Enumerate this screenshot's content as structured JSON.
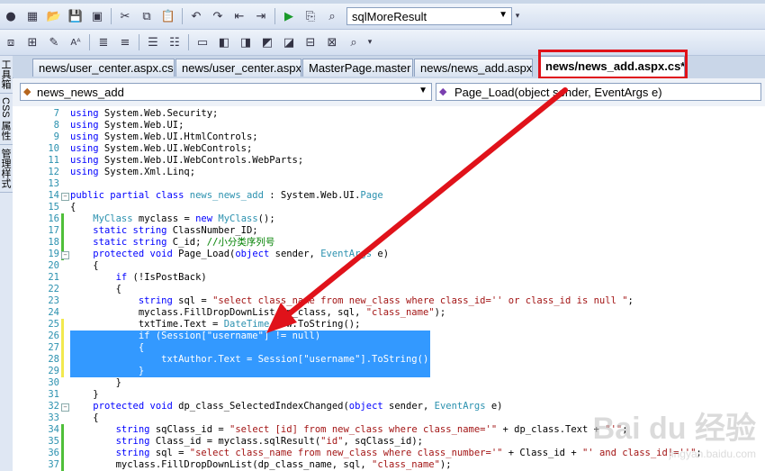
{
  "toolbar1": {
    "config_combo": "sqlMoreResult"
  },
  "left_panel": {
    "tabs": [
      "工具箱",
      "CSS 属性",
      "管理样式"
    ]
  },
  "document_tabs": [
    {
      "label": "news/user_center.aspx.cs"
    },
    {
      "label": "news/user_center.aspx"
    },
    {
      "label": "MasterPage.master"
    },
    {
      "label": "news/news_add.aspx"
    },
    {
      "label": "news/news_add.aspx.cs*"
    }
  ],
  "nav": {
    "class_combo": "news_news_add",
    "member_combo": "Page_Load(object sender, EventArgs e)"
  },
  "code": {
    "lines": [
      {
        "n": "7",
        "html": "<span class=\"kw\">using</span> System.Web.Security;"
      },
      {
        "n": "8",
        "html": "<span class=\"kw\">using</span> System.Web.UI;"
      },
      {
        "n": "9",
        "html": "<span class=\"kw\">using</span> System.Web.UI.HtmlControls;"
      },
      {
        "n": "10",
        "html": "<span class=\"kw\">using</span> System.Web.UI.WebControls;"
      },
      {
        "n": "11",
        "html": "<span class=\"kw\">using</span> System.Web.UI.WebControls.WebParts;"
      },
      {
        "n": "12",
        "html": "<span class=\"kw\">using</span> System.Xml.Linq;"
      },
      {
        "n": "13",
        "html": ""
      },
      {
        "n": "14",
        "html": "<span class=\"kw\">public partial class</span> <span class=\"ty\">news_news_add</span> : System.Web.UI.<span class=\"ty\">Page</span>"
      },
      {
        "n": "15",
        "html": "{"
      },
      {
        "n": "16",
        "html": "    <span class=\"ty\">MyClass</span> myclass = <span class=\"kw\">new</span> <span class=\"ty\">MyClass</span>();"
      },
      {
        "n": "17",
        "html": "    <span class=\"kw\">static string</span> ClassNumber_ID;"
      },
      {
        "n": "18",
        "html": "    <span class=\"kw\">static string</span> C_id; <span class=\"cm\">//小分类序列号</span>"
      },
      {
        "n": "19",
        "html": "    <span class=\"kw\">protected void</span> Page_Load(<span class=\"kw\">object</span> sender, <span class=\"ty\">EventArgs</span> e)"
      },
      {
        "n": "20",
        "html": "    {"
      },
      {
        "n": "21",
        "html": "        <span class=\"kw\">if</span> (!IsPostBack)"
      },
      {
        "n": "22",
        "html": "        {"
      },
      {
        "n": "23",
        "html": "            <span class=\"kw\">string</span> sql = <span class=\"st\">\"select class_name from new_class where class_id='' or class_id is null \"</span>;"
      },
      {
        "n": "24",
        "html": "            myclass.FillDropDownList(dp_class, sql, <span class=\"st\">\"class_name\"</span>);"
      },
      {
        "n": "25",
        "html": "            txtTime.Text = <span class=\"ty\">DateTime</span>.Now.ToString();"
      },
      {
        "n": "26",
        "sel": true,
        "html": "            <span class=\"kw\">if</span> (Session[<span class=\"st\">\"username\"</span>] != <span class=\"kw\">null</span>)"
      },
      {
        "n": "27",
        "sel": true,
        "html": "            {"
      },
      {
        "n": "28",
        "sel": true,
        "html": "                txtAuthor.Text = Session[<span class=\"st\">\"username\"</span>].ToString();"
      },
      {
        "n": "29",
        "sel": true,
        "html": "            }"
      },
      {
        "n": "30",
        "html": "        }"
      },
      {
        "n": "31",
        "html": "    }"
      },
      {
        "n": "32",
        "html": "    <span class=\"kw\">protected void</span> dp_class_SelectedIndexChanged(<span class=\"kw\">object</span> sender, <span class=\"ty\">EventArgs</span> e)"
      },
      {
        "n": "33",
        "html": "    {"
      },
      {
        "n": "34",
        "html": "        <span class=\"kw\">string</span> sqClass_id = <span class=\"st\">\"select [id] from new_class where class_name='\"</span> + dp_class.Text + <span class=\"st\">\"'\"</span>;"
      },
      {
        "n": "35",
        "html": "        <span class=\"kw\">string</span> Class_id = myclass.sqlResult(<span class=\"st\">\"id\"</span>, sqClass_id);"
      },
      {
        "n": "36",
        "html": "        <span class=\"kw\">string</span> sql = <span class=\"st\">\"select class_name from new_class where class_number='\"</span> + Class_id + <span class=\"st\">\"' and class_id!=''\"</span>;"
      },
      {
        "n": "37",
        "html": "        myclass.FillDropDownList(dp_class_name, sql, <span class=\"st\">\"class_name\"</span>);"
      }
    ]
  },
  "watermark": {
    "text": "Bai du 经验",
    "sub": "jingyan.baidu.com"
  }
}
